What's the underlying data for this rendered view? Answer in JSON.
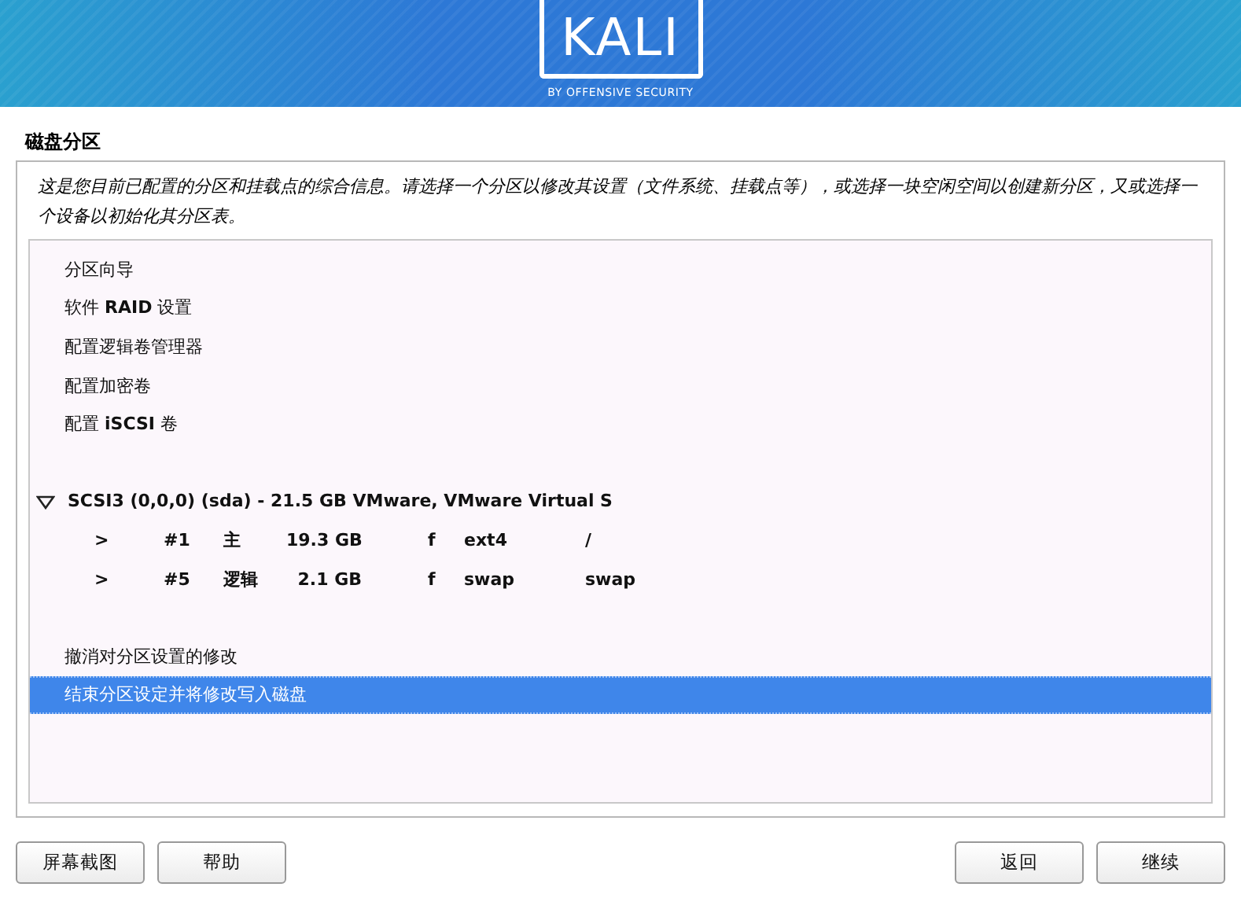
{
  "banner": {
    "logo": "KALI",
    "tagline": "BY OFFENSIVE SECURITY"
  },
  "title": "磁盘分区",
  "description": "这是您目前已配置的分区和挂载点的综合信息。请选择一个分区以修改其设置（文件系统、挂载点等），或选择一块空闲空间以创建新分区，又或选择一个设备以初始化其分区表。",
  "items": [
    {
      "kind": "item",
      "label": "分区向导",
      "selected": false
    },
    {
      "kind": "item",
      "label": "软件 **RAID** 设置",
      "selected": false
    },
    {
      "kind": "item",
      "label": "配置逻辑卷管理器",
      "selected": false
    },
    {
      "kind": "item",
      "label": "配置加密卷",
      "selected": false
    },
    {
      "kind": "item",
      "label": "配置 **iSCSI** 卷",
      "selected": false
    },
    {
      "kind": "spacer"
    },
    {
      "kind": "disk",
      "label": "SCSI3 (0,0,0) (sda) - 21.5 GB VMware, VMware Virtual S",
      "expanded": true,
      "selected": false
    },
    {
      "kind": "partition",
      "columns": [
        ">",
        "#1",
        "主",
        "19.3 GB",
        "f",
        "ext4",
        "/"
      ],
      "selected": false
    },
    {
      "kind": "partition",
      "columns": [
        ">",
        "#5",
        "逻辑",
        "2.1 GB",
        "f",
        "swap",
        "swap"
      ],
      "selected": false
    },
    {
      "kind": "spacer"
    },
    {
      "kind": "item",
      "label": "撤消对分区设置的修改",
      "selected": false
    },
    {
      "kind": "item",
      "label": "结束分区设定并将修改写入磁盘",
      "selected": true
    }
  ],
  "buttons_left": [
    "屏幕截图",
    "帮助"
  ],
  "buttons_right": [
    "返回",
    "继续"
  ]
}
